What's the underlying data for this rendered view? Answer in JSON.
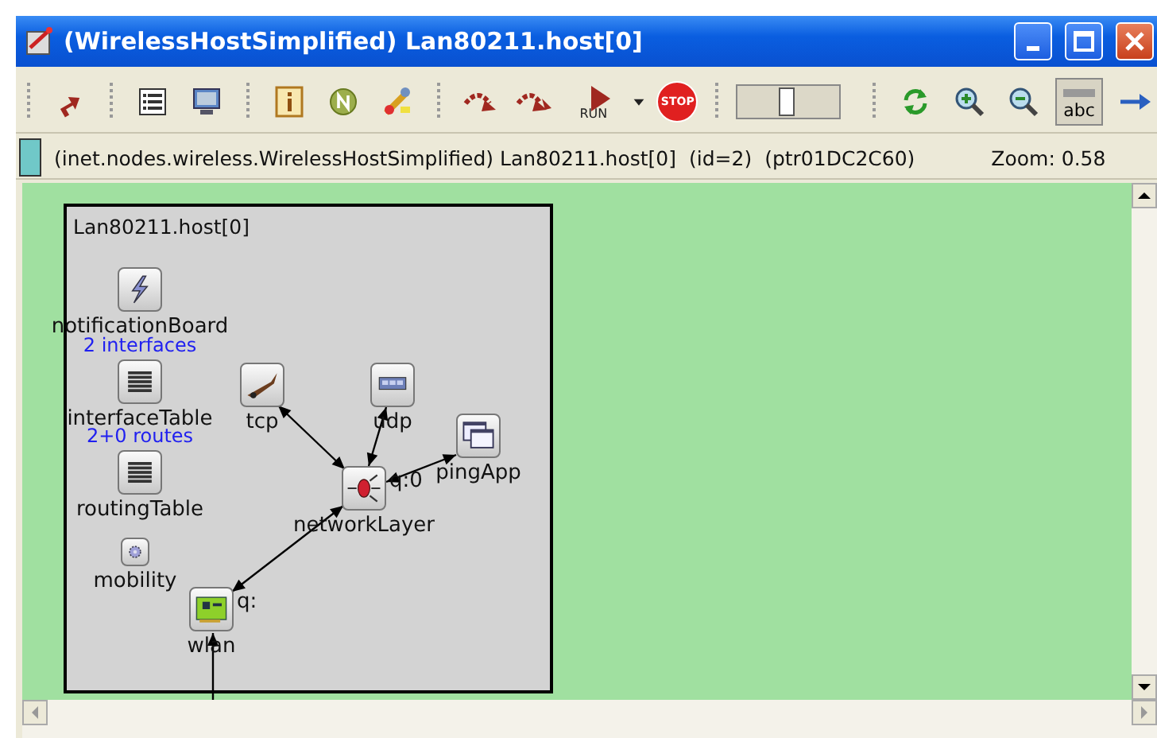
{
  "window": {
    "title": "(WirelessHostSimplified) Lan80211.host[0]"
  },
  "toolbar": {
    "run_label": "RUN",
    "stop_label": "STOP",
    "labels_toggle": "abc",
    "speed_slider": {
      "level": 0.45
    }
  },
  "info_bar": {
    "path": "(inet.nodes.wireless.WirelessHostSimplified) Lan80211.host[0]",
    "id": "(id=2)",
    "pointer": "(ptr01DC2C60)",
    "zoom": "Zoom: 0.58"
  },
  "diagram": {
    "module_title": "Lan80211.host[0]",
    "nodes": [
      {
        "name": "notificationBoard",
        "kind": "board"
      },
      {
        "name": "interfaceTable",
        "kind": "table",
        "info": "2 interfaces"
      },
      {
        "name": "routingTable",
        "kind": "table",
        "info": "2+0 routes"
      },
      {
        "name": "mobility",
        "kind": "gear"
      },
      {
        "name": "tcp",
        "kind": "tcp"
      },
      {
        "name": "udp",
        "kind": "udp"
      },
      {
        "name": "networkLayer",
        "kind": "router",
        "queue": "q:0"
      },
      {
        "name": "pingApp",
        "kind": "app"
      },
      {
        "name": "wlan",
        "kind": "card",
        "queue": "q:"
      }
    ]
  }
}
